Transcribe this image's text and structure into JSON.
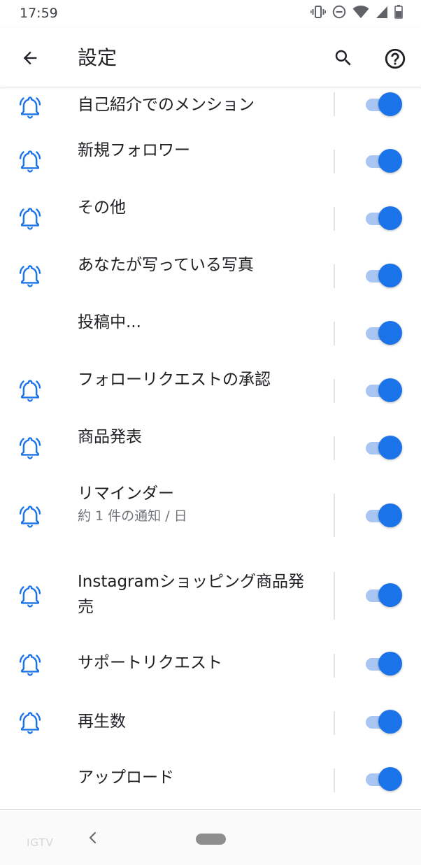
{
  "status_bar": {
    "time": "17:59",
    "icons": [
      "vibrate-icon",
      "do-not-disturb-icon",
      "wifi-icon",
      "cell-signal-icon",
      "battery-icon"
    ]
  },
  "app_bar": {
    "title": "設定",
    "back_icon": "arrow-back-icon",
    "search_icon": "search-icon",
    "help_icon": "help-circle-icon"
  },
  "settings_items": [
    {
      "label": "自己紹介でのメンション",
      "sub": "",
      "has_bell": true,
      "enabled": true
    },
    {
      "label": "新規フォロワー",
      "sub": "",
      "has_bell": true,
      "enabled": true
    },
    {
      "label": "その他",
      "sub": "",
      "has_bell": true,
      "enabled": true
    },
    {
      "label": "あなたが写っている写真",
      "sub": "",
      "has_bell": true,
      "enabled": true
    },
    {
      "label": "投稿中...",
      "sub": "",
      "has_bell": false,
      "enabled": true
    },
    {
      "label": "フォローリクエストの承認",
      "sub": "",
      "has_bell": true,
      "enabled": true
    },
    {
      "label": "商品発表",
      "sub": "",
      "has_bell": true,
      "enabled": true
    },
    {
      "label": "リマインダー",
      "sub": "約 1 件の通知 / 日",
      "has_bell": true,
      "enabled": true
    },
    {
      "label": "Instagramショッピング商品発売",
      "sub": "",
      "has_bell": true,
      "enabled": true
    },
    {
      "label": "サポートリクエスト",
      "sub": "",
      "has_bell": true,
      "enabled": true
    },
    {
      "label": "再生数",
      "sub": "",
      "has_bell": true,
      "enabled": true
    },
    {
      "label": "アップロード",
      "sub": "",
      "has_bell": false,
      "enabled": true
    }
  ],
  "nav_bar": {
    "faded_label": "IGTV",
    "back_icon": "nav-back-chevron-icon",
    "home_icon": "home-pill-icon"
  },
  "colors": {
    "accent": "#1a73e8",
    "toggle_track_on": "#a9c6f2",
    "text_primary": "#202124",
    "text_secondary": "#70757a"
  }
}
